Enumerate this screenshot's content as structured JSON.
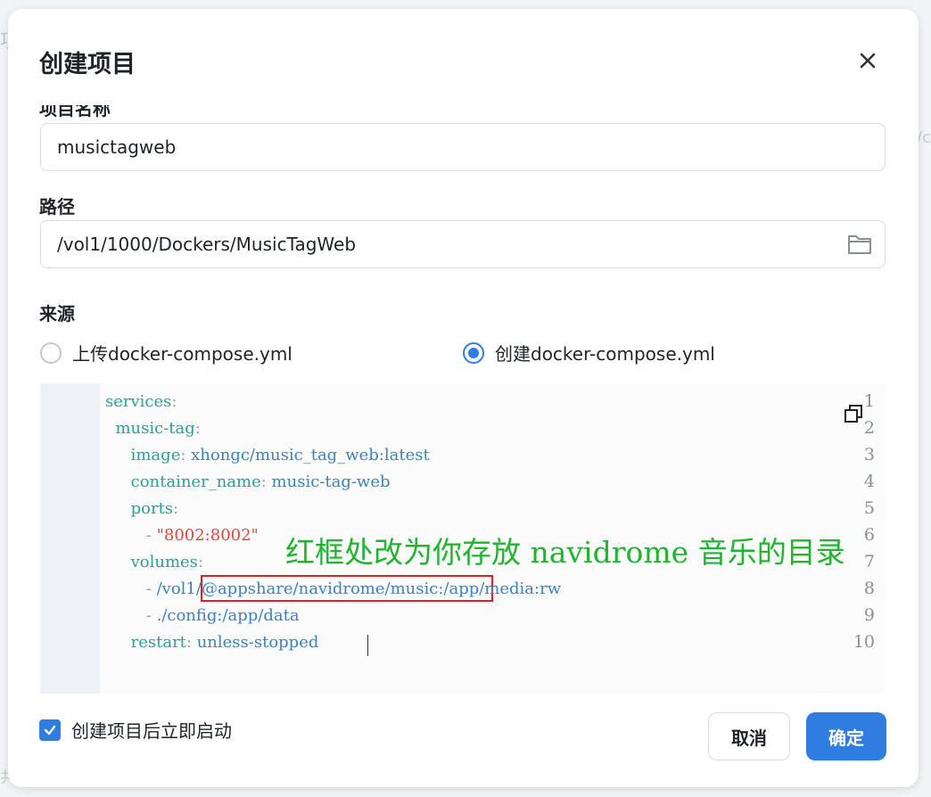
{
  "dialog": {
    "title": "创建项目",
    "name_label": "项目名称",
    "name_value": "musictagweb",
    "path_label": "路径",
    "path_value": "/vol1/1000/Dockers/MusicTagWeb",
    "source_label": "来源",
    "source_options": [
      {
        "label": "上传docker-compose.yml",
        "selected": false
      },
      {
        "label": "创建docker-compose.yml",
        "selected": true
      }
    ],
    "auto_start_label": "创建项目后立即启动",
    "auto_start_checked": true,
    "cancel_label": "取消",
    "confirm_label": "确定"
  },
  "editor": {
    "line_numbers": [
      "1",
      "2",
      "3",
      "4",
      "5",
      "6",
      "7",
      "8",
      "9",
      "10"
    ],
    "lines": [
      {
        "indent": "",
        "key": "services",
        "sep": ":",
        "value": ""
      },
      {
        "indent": "  ",
        "key": "music-tag",
        "sep": ":",
        "value": ""
      },
      {
        "indent": "     ",
        "key": "image",
        "sep": ": ",
        "value": "xhongc/music_tag_web:latest"
      },
      {
        "indent": "     ",
        "key": "container_name",
        "sep": ": ",
        "value": "music-tag-web"
      },
      {
        "indent": "     ",
        "key": "ports",
        "sep": ":",
        "value": ""
      },
      {
        "indent": "        ",
        "dash": "- ",
        "string": "\"8002:8002\""
      },
      {
        "indent": "     ",
        "key": "volumes",
        "sep": ":",
        "value": ""
      },
      {
        "indent": "        ",
        "dash": "- ",
        "value": "/vol1/@appshare/navidrome/music:/app/media:rw"
      },
      {
        "indent": "        ",
        "dash": "- ",
        "value": "./config:/app/data"
      },
      {
        "indent": "     ",
        "key": "restart",
        "sep": ": ",
        "value": "unless-stopped"
      }
    ],
    "annotation": "红框处改为你存放 navidrome 音乐的目录"
  },
  "colors": {
    "accent": "#2f7de1",
    "yaml_key": "#2aa198",
    "yaml_value": "#3b82c4",
    "yaml_string": "#e0463c",
    "annotation": "#1fb52f",
    "highlight_box": "#e02020"
  },
  "icons": {
    "close": "close-icon",
    "folder": "folder-icon",
    "copy": "copy-icon",
    "check": "check-icon"
  }
}
